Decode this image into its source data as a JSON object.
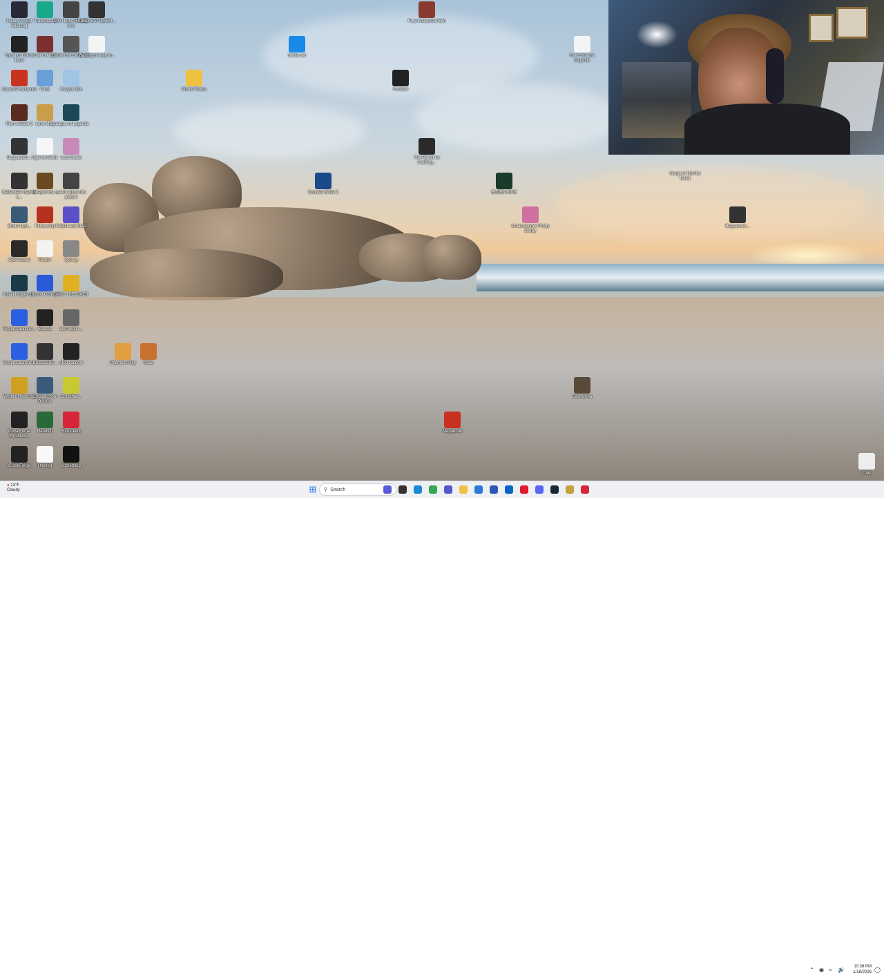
{
  "desktop_icons": [
    {
      "label": "Hollow Knight Silksong",
      "icon": "hollow-knight-icon",
      "color": "#2a2a36"
    },
    {
      "label": "Trackmania",
      "icon": "trackmania-icon",
      "color": "#1aa88a"
    },
    {
      "label": "100 Hours Rebuild Iron",
      "icon": "car-icon",
      "color": "#444"
    },
    {
      "label": "PUBG BATTLEGR...",
      "icon": "pubg-icon",
      "color": "#333"
    },
    {
      "label": "Trying to Follow Lace",
      "icon": "line-icon",
      "color": "#222"
    },
    {
      "label": "Call to Arms",
      "icon": "soldiers-icon",
      "color": "#7a3030"
    },
    {
      "label": "Battlefront Simulator",
      "icon": "gear-icon",
      "color": "#555"
    },
    {
      "label": "Wasting money to...",
      "icon": "blank-doc-icon",
      "color": "#f4f4f4"
    },
    {
      "label": "Sacred Providence",
      "icon": "sacred-icon",
      "color": "#c8321e"
    },
    {
      "label": "Prool",
      "icon": "prool-icon",
      "color": "#6aa0d8"
    },
    {
      "label": "Recycle Bin",
      "icon": "recycle-bin-icon",
      "color": "#9fc4e4"
    },
    {
      "label": "World Photos",
      "icon": "folder-icon",
      "color": "#f0c040"
    },
    {
      "label": "Path of Exile 2",
      "icon": "poe-icon",
      "color": "#5a2c20"
    },
    {
      "label": "Lens Map",
      "icon": "map-icon",
      "color": "#c89e4a"
    },
    {
      "label": "League of Legends",
      "icon": "league-icon",
      "color": "#1a4a58"
    },
    {
      "label": "BsgLaunch...",
      "icon": "bsg-launcher-icon",
      "color": "#333"
    },
    {
      "label": "High Ab Mode",
      "icon": "window-icon",
      "color": "#f6f6f6"
    },
    {
      "label": "Lost Castle",
      "icon": "castle-icon",
      "color": "#c88ab8"
    },
    {
      "label": "Battlestate Games L...",
      "icon": "battlestate-icon",
      "color": "#333"
    },
    {
      "label": "Intrepid Inst...",
      "icon": "intrepid-icon",
      "color": "#6a4a20"
    },
    {
      "label": "Learn about this picture",
      "icon": "camera-icon",
      "color": "#444"
    },
    {
      "label": "Shure-Upd...",
      "icon": "shure-icon",
      "color": "#3a5a7a"
    },
    {
      "label": "Fellowship",
      "icon": "fellowship-icon",
      "color": "#b83020"
    },
    {
      "label": "Rabbit and Steel",
      "icon": "rabbit-icon",
      "color": "#5a50c8"
    },
    {
      "label": "OBS Studio",
      "icon": "obs-icon",
      "color": "#2a2a2a"
    },
    {
      "label": "Heater",
      "icon": "window-icon",
      "color": "#f2f2f2"
    },
    {
      "label": "Specsy",
      "icon": "specsy-icon",
      "color": "#888"
    },
    {
      "label": "Install League o...",
      "icon": "league-install-icon",
      "color": "#1a3a48"
    },
    {
      "label": "Ubisoft Connect",
      "icon": "ubisoft-icon",
      "color": "#2a5ad8"
    },
    {
      "label": "DAVE THE DIVER",
      "icon": "dave-icon",
      "color": "#e0b020"
    },
    {
      "label": "Tempo Launche...",
      "icon": "tempo-icon",
      "color": "#2a60e0"
    },
    {
      "label": "Blasted",
      "icon": "window-icon",
      "color": "#222"
    },
    {
      "label": "obs-multi-r...",
      "icon": "obs-multi-icon",
      "color": "#666"
    },
    {
      "label": "Tempo Launche...",
      "icon": "tempo-icon",
      "color": "#2a60e0"
    },
    {
      "label": "BALLBUST...",
      "icon": "ball-icon",
      "color": "#333"
    },
    {
      "label": "ARC Raiders",
      "icon": "arc-icon",
      "color": "#222"
    },
    {
      "label": "Phantom Play",
      "icon": "phantom-icon",
      "color": "#e0a040"
    },
    {
      "label": "Noita",
      "icon": "noita-icon",
      "color": "#c87030"
    },
    {
      "label": "World of Warcraft",
      "icon": "wow-icon",
      "color": "#d0a020"
    },
    {
      "label": "Escape From Duckov",
      "icon": "duck-icon",
      "color": "#3a5a7a"
    },
    {
      "label": "Crosshair...",
      "icon": "crosshair-icon",
      "color": "#c8c830"
    },
    {
      "label": "CurseForge Windows...",
      "icon": "curseforge-icon",
      "color": "#222"
    },
    {
      "label": "Hades II",
      "icon": "hades-icon",
      "color": "#2a6a3a"
    },
    {
      "label": "Riot Client",
      "icon": "riot-icon",
      "color": "#d8253a"
    },
    {
      "label": "CurseForge",
      "icon": "curseforge-icon",
      "color": "#222"
    },
    {
      "label": "Untitled",
      "icon": "blank-doc-icon",
      "color": "#f8f8f8"
    },
    {
      "label": "something",
      "icon": "dark-image-icon",
      "color": "#111"
    },
    {
      "label": "Battle.net",
      "icon": "battlenet-icon",
      "color": "#1a8ae8"
    },
    {
      "label": "Fury Unleashed Sim",
      "icon": "fury-icon",
      "color": "#8a3a30"
    },
    {
      "label": "Football",
      "icon": "football-icon",
      "color": "#222"
    },
    {
      "label": "The Planet for Crafting...",
      "icon": "planet-icon",
      "color": "#2a2a2a"
    },
    {
      "label": "Counter-Strike 2",
      "icon": "cs2-icon",
      "color": "#1a4a8a"
    },
    {
      "label": "ELDEN RING",
      "icon": "elden-ring-icon",
      "color": "#1a3a2a"
    },
    {
      "label": "Umamusume: Pretty Derby",
      "icon": "umamusume-icon",
      "color": "#d070a0"
    },
    {
      "label": "Raid Shadow Legends",
      "icon": "blank-doc-icon",
      "color": "#f4f4f4"
    },
    {
      "label": "Gorge or Not the Dead",
      "icon": "blank",
      "color": "#000000"
    },
    {
      "label": "BsgLaunch...",
      "icon": "bsg-launcher-icon",
      "color": "#333"
    },
    {
      "label": "Deo Arena",
      "icon": "deo-icon",
      "color": "#5a4a3a"
    },
    {
      "label": "Megabonk",
      "icon": "megabonk-icon",
      "color": "#c83020"
    },
    {
      "label": "Glay",
      "icon": "glay-icon",
      "color": "#eee"
    }
  ],
  "webcam": {
    "label": "webcam-overlay"
  },
  "taskbar": {
    "search_placeholder": "Search",
    "weather_temp": "13°F",
    "weather_desc": "Cloudy",
    "time": "10:38 PM",
    "date": "1/18/2026",
    "pinned": [
      "start-icon",
      "search-icon",
      "widgets-icon",
      "task-view-icon",
      "edge-icon",
      "chrome-icon",
      "teams-icon",
      "file-explorer-icon",
      "file-manager-icon",
      "store-icon",
      "outlook-icon",
      "opera-icon",
      "discord-icon",
      "steam-icon",
      "league-icon",
      "riot-icon"
    ]
  }
}
